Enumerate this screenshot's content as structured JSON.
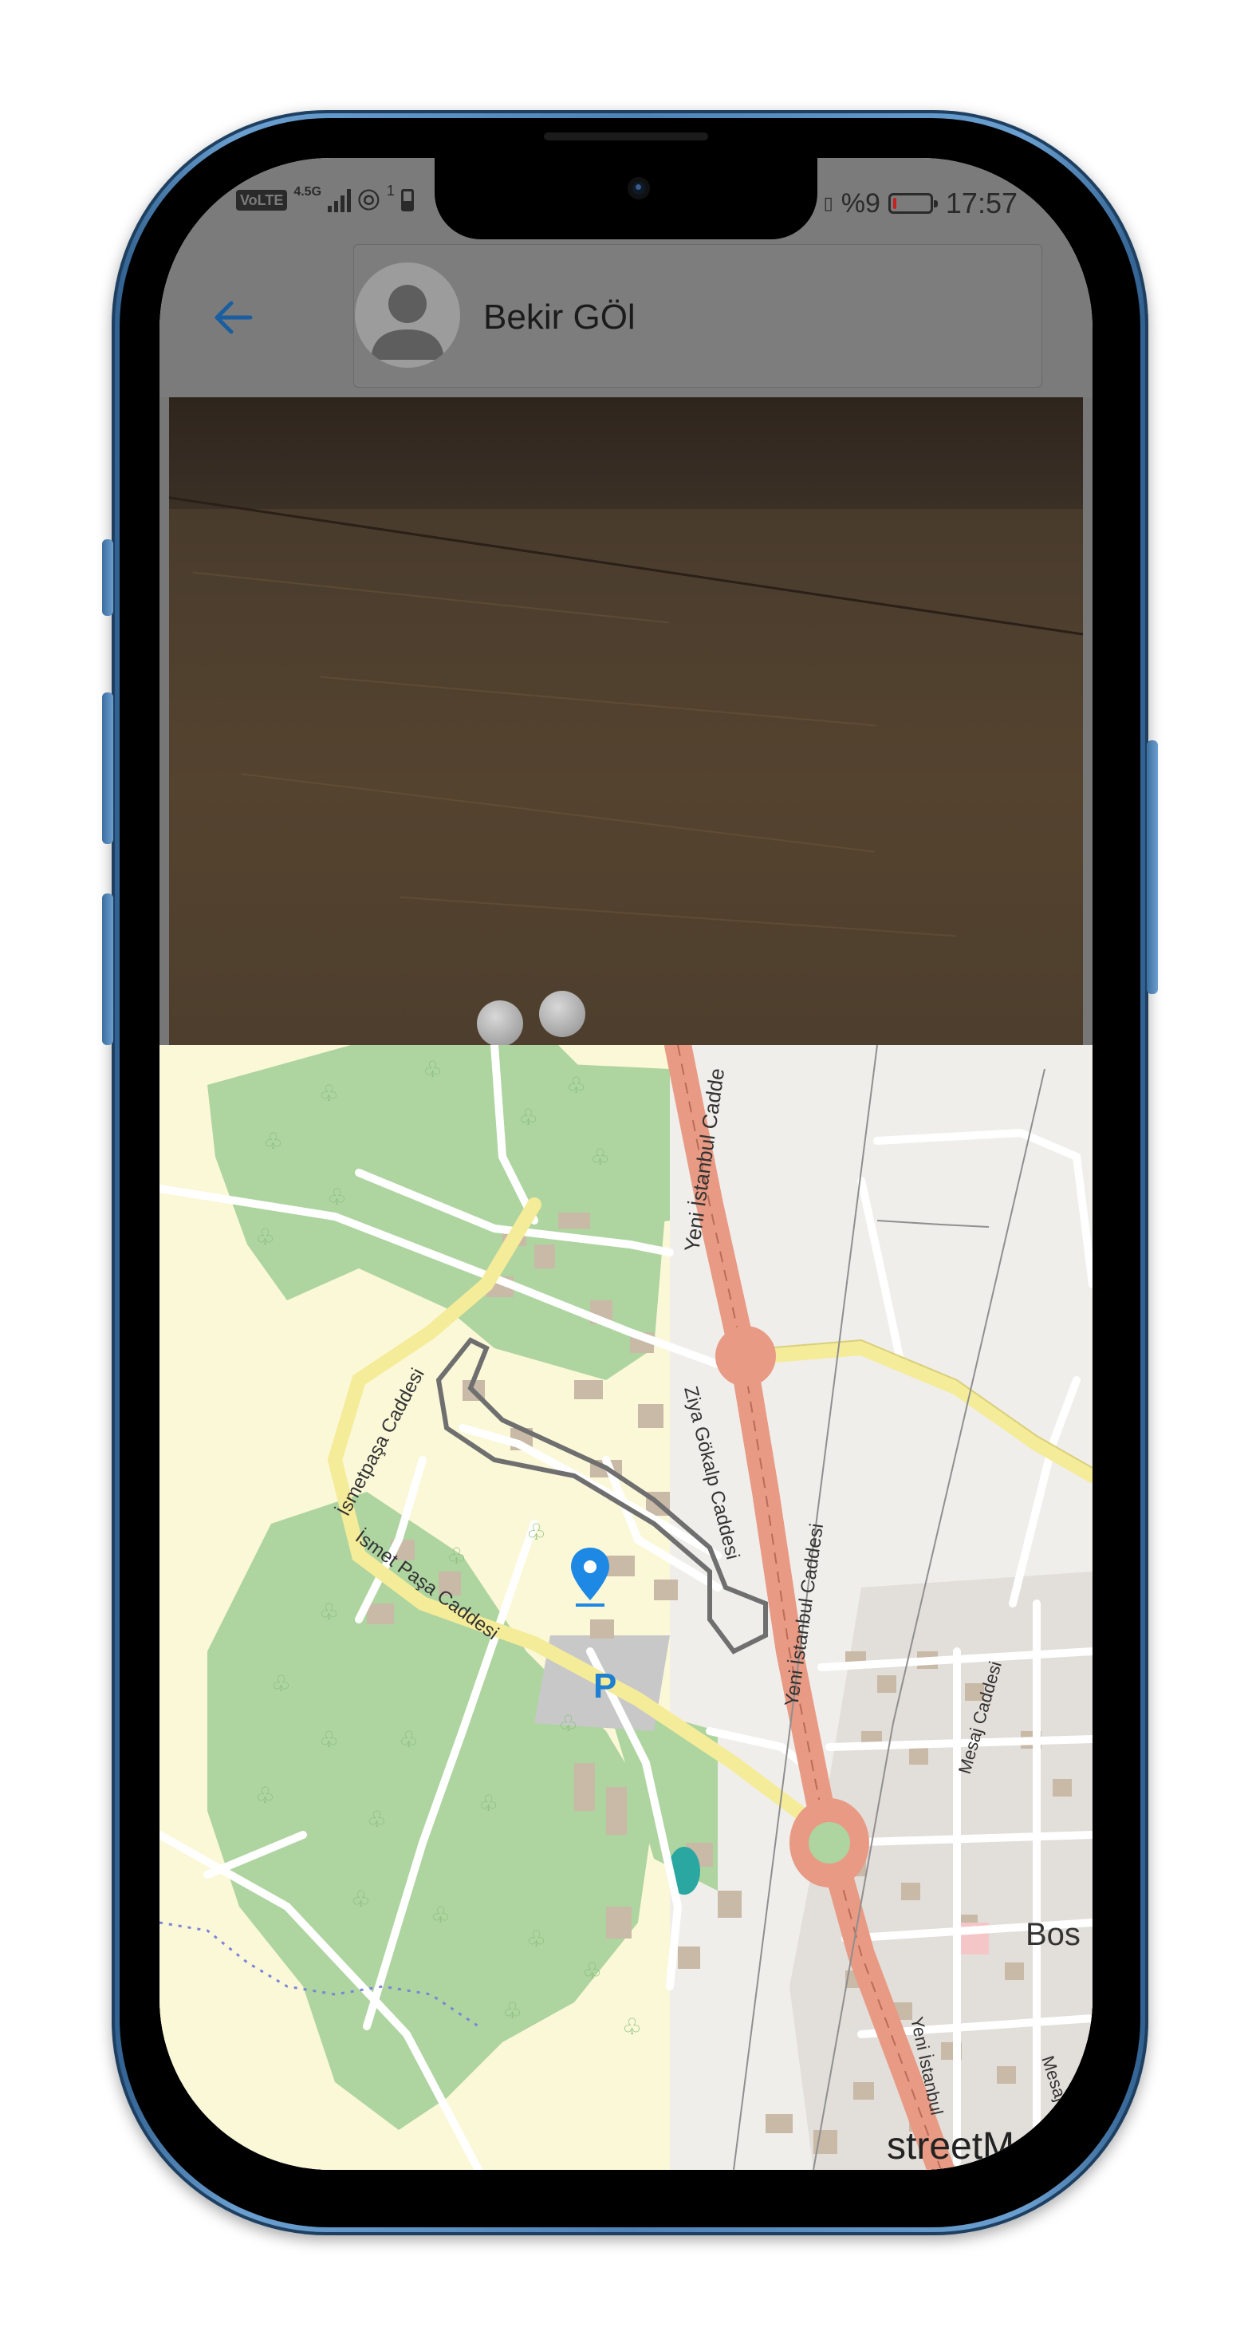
{
  "status_bar": {
    "volte_label": "VoLTE",
    "network_type": "4.5G",
    "sim_index": "1",
    "battery_percent": "%9",
    "battery_level": 0.09,
    "time": "17:57",
    "battery_color": "#c81f1f"
  },
  "header": {
    "back_icon": "arrow-left-icon",
    "contact_name": "Bekir GÖl",
    "avatar_icon": "person-placeholder-icon",
    "accent_color": "#1976d2"
  },
  "camera_preview": {
    "description_icon": "camera-viewfinder"
  },
  "map": {
    "street_labels": [
      "Yeni İstanbul Cadde",
      "İsmetpaşa Caddesi",
      "İsmet Paşa Caddesi",
      "Ziya Gökalp Caddesi",
      "Yeni İstanbul Caddesi",
      "Mesaj Caddesi",
      "Yeni İstanbul",
      "Mesaj"
    ],
    "place_label": "Bos",
    "parking_label": "P",
    "pin_icon": "location-pin-icon",
    "attribution": "streetMap"
  }
}
